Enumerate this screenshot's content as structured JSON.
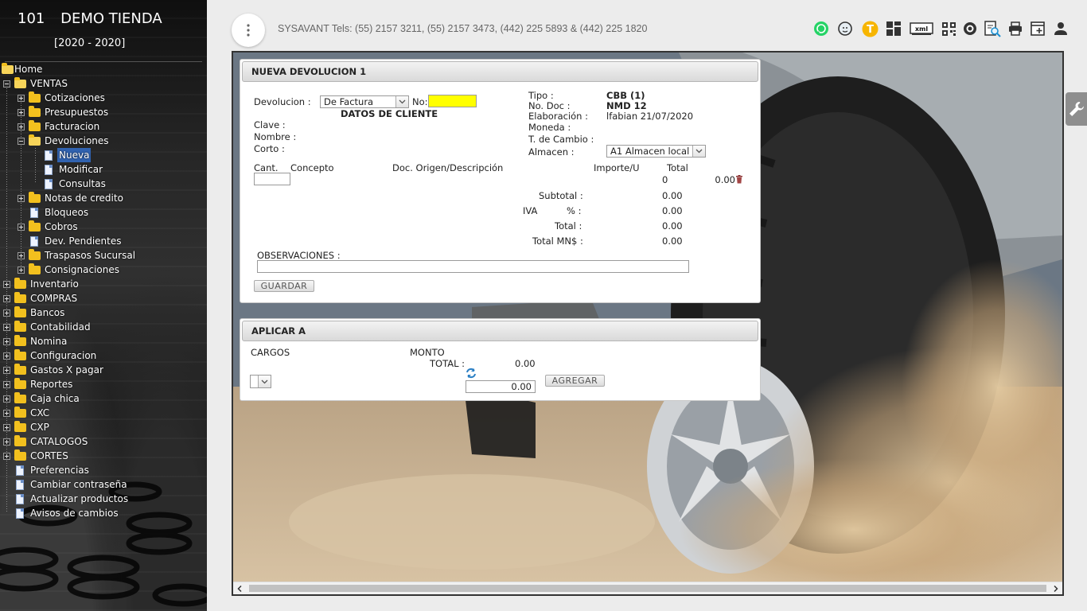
{
  "store": {
    "number": "101",
    "name": "DEMO TIENDA",
    "years": "[2020 - 2020]"
  },
  "sidebar": {
    "tree": [
      {
        "label": "Home",
        "level": 0,
        "icon": "folder-open",
        "expander": "none"
      },
      {
        "label": "VENTAS",
        "level": 1,
        "icon": "folder-open",
        "expander": "minus"
      },
      {
        "label": "Cotizaciones",
        "level": 2,
        "icon": "folder",
        "expander": "plus"
      },
      {
        "label": "Presupuestos",
        "level": 2,
        "icon": "folder",
        "expander": "plus"
      },
      {
        "label": "Facturacion",
        "level": 2,
        "icon": "folder",
        "expander": "plus"
      },
      {
        "label": "Devoluciones",
        "level": 2,
        "icon": "folder-open",
        "expander": "minus"
      },
      {
        "label": "Nueva",
        "level": 3,
        "icon": "doc",
        "expander": "none",
        "selected": true
      },
      {
        "label": "Modificar",
        "level": 3,
        "icon": "doc",
        "expander": "none"
      },
      {
        "label": "Consultas",
        "level": 3,
        "icon": "doc",
        "expander": "none"
      },
      {
        "label": "Notas de credito",
        "level": 2,
        "icon": "folder",
        "expander": "plus"
      },
      {
        "label": "Bloqueos",
        "level": 2,
        "icon": "doc",
        "expander": "none"
      },
      {
        "label": "Cobros",
        "level": 2,
        "icon": "folder",
        "expander": "plus"
      },
      {
        "label": "Dev. Pendientes",
        "level": 2,
        "icon": "doc",
        "expander": "none"
      },
      {
        "label": "Traspasos Sucursal",
        "level": 2,
        "icon": "folder",
        "expander": "plus"
      },
      {
        "label": "Consignaciones",
        "level": 2,
        "icon": "folder",
        "expander": "plus"
      },
      {
        "label": "Inventario",
        "level": 1,
        "icon": "folder",
        "expander": "plus"
      },
      {
        "label": "COMPRAS",
        "level": 1,
        "icon": "folder",
        "expander": "plus"
      },
      {
        "label": "Bancos",
        "level": 1,
        "icon": "folder",
        "expander": "plus"
      },
      {
        "label": "Contabilidad",
        "level": 1,
        "icon": "folder",
        "expander": "plus"
      },
      {
        "label": "Nomina",
        "level": 1,
        "icon": "folder",
        "expander": "plus"
      },
      {
        "label": "Configuracion",
        "level": 1,
        "icon": "folder",
        "expander": "plus"
      },
      {
        "label": "Gastos X pagar",
        "level": 1,
        "icon": "folder",
        "expander": "plus"
      },
      {
        "label": "Reportes",
        "level": 1,
        "icon": "folder",
        "expander": "plus"
      },
      {
        "label": "Caja chica",
        "level": 1,
        "icon": "folder",
        "expander": "plus"
      },
      {
        "label": "CXC",
        "level": 1,
        "icon": "folder",
        "expander": "plus"
      },
      {
        "label": "CXP",
        "level": 1,
        "icon": "folder",
        "expander": "plus"
      },
      {
        "label": "CATALOGOS",
        "level": 1,
        "icon": "folder",
        "expander": "plus"
      },
      {
        "label": "CORTES",
        "level": 1,
        "icon": "folder",
        "expander": "plus"
      },
      {
        "label": "Preferencias",
        "level": 1,
        "icon": "doc",
        "expander": "none"
      },
      {
        "label": "Cambiar contraseña",
        "level": 1,
        "icon": "doc",
        "expander": "none"
      },
      {
        "label": "Actualizar productos",
        "level": 1,
        "icon": "doc",
        "expander": "none"
      },
      {
        "label": "Avisos de cambios",
        "level": 1,
        "icon": "doc",
        "expander": "none"
      }
    ]
  },
  "topbar": {
    "menu_icon": "more-vertical-icon",
    "contact": "SYSAVANT Tels: (55) 2157 3211, (55) 2157 3473, (442) 225 5893 & (442) 225 1820",
    "toolbar_icons": [
      "whatsapp-icon",
      "support-agent-icon",
      "t-badge-icon",
      "dashboard-icon",
      "xml-icon",
      "qr-code-icon",
      "settings-circle-icon",
      "document-search-icon",
      "print-icon",
      "new-window-icon",
      "user-icon"
    ],
    "t_badge": "T",
    "xml_label": "xml"
  },
  "devolucion": {
    "title": "NUEVA DEVOLUCION 1",
    "devolucion_label": "Devolucion :",
    "devolucion_value": "De Factura",
    "no_label": "No:",
    "no_value": "",
    "cliente_header": "DATOS DE CLIENTE",
    "clave_label": "Clave :",
    "nombre_label": "Nombre :",
    "corto_label": "Corto :",
    "tipo_label": "Tipo :",
    "tipo_value": "CBB (1)",
    "nodoc_label": "No. Doc :",
    "nodoc_value": "NMD 12",
    "elaboracion_label": "Elaboración :",
    "elaboracion_value": "lfabian 21/07/2020",
    "moneda_label": "Moneda :",
    "tcambio_label": "T. de Cambio :",
    "almacen_label": "Almacen :",
    "almacen_value": "A1 Almacen local",
    "columns": {
      "cant": "Cant.",
      "concepto": "Concepto",
      "doc_origen": "Doc. Origen/Descripción",
      "importe": "Importe/U",
      "total": "Total"
    },
    "row": {
      "importe": "0",
      "total": "0.00"
    },
    "subtotal_label": "Subtotal :",
    "subtotal_value": "0.00",
    "iva_label": "IVA",
    "pct_label": "% :",
    "iva_value": "0.00",
    "total_label": "Total :",
    "total_value": "0.00",
    "totalmn_label": "Total MN$ :",
    "totalmn_value": "0.00",
    "observaciones_label": "OBSERVACIONES :",
    "observaciones_value": "",
    "guardar_label": "GUARDAR"
  },
  "aplicar": {
    "title": "APLICAR A",
    "cargos_label": "CARGOS",
    "monto_label": "MONTO",
    "total_label": "TOTAL :",
    "total_value": "0.00",
    "amount_value": "0.00",
    "agregar_label": "AGREGAR"
  },
  "colors": {
    "highlight_yellow": "#ffff00",
    "selection_blue": "#3163b0",
    "folder": "#f2c01e",
    "whatsapp": "#25d366",
    "badge": "#f7b500"
  }
}
